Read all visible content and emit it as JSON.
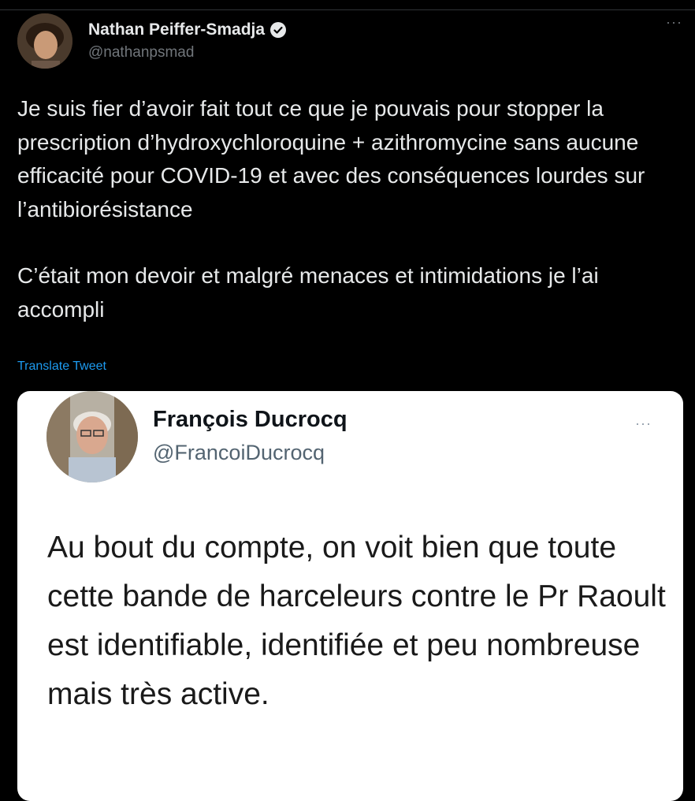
{
  "tweet": {
    "author_name": "Nathan Peiffer-Smadja",
    "author_handle": "@nathanpsmad",
    "paragraph_1": "Je suis fier d’avoir fait tout ce que je pouvais pour stopper la prescription d’hydroxychloroquine + azithromycine sans aucune efficacité pour COVID-19 et avec des conséquences lourdes sur l’antibiorésistance",
    "paragraph_2": "C’était mon devoir et malgré menaces et intimidations je l’ai accompli",
    "translate_label": "Translate Tweet",
    "more_label": "···",
    "verified_icon": "verified-badge-icon"
  },
  "quoted": {
    "author_name": "François Ducrocq",
    "author_handle": "@FrancoiDucrocq",
    "text": "Au bout du compte, on voit bien que toute cette bande de harceleurs contre le Pr Raoult est identifiable, identifiée et peu nombreuse mais très active.",
    "more_label": "···"
  },
  "colors": {
    "background": "#000000",
    "text": "#e7e9ea",
    "secondary": "#71767b",
    "link": "#1d9bf0",
    "quoted_background": "#ffffff"
  }
}
